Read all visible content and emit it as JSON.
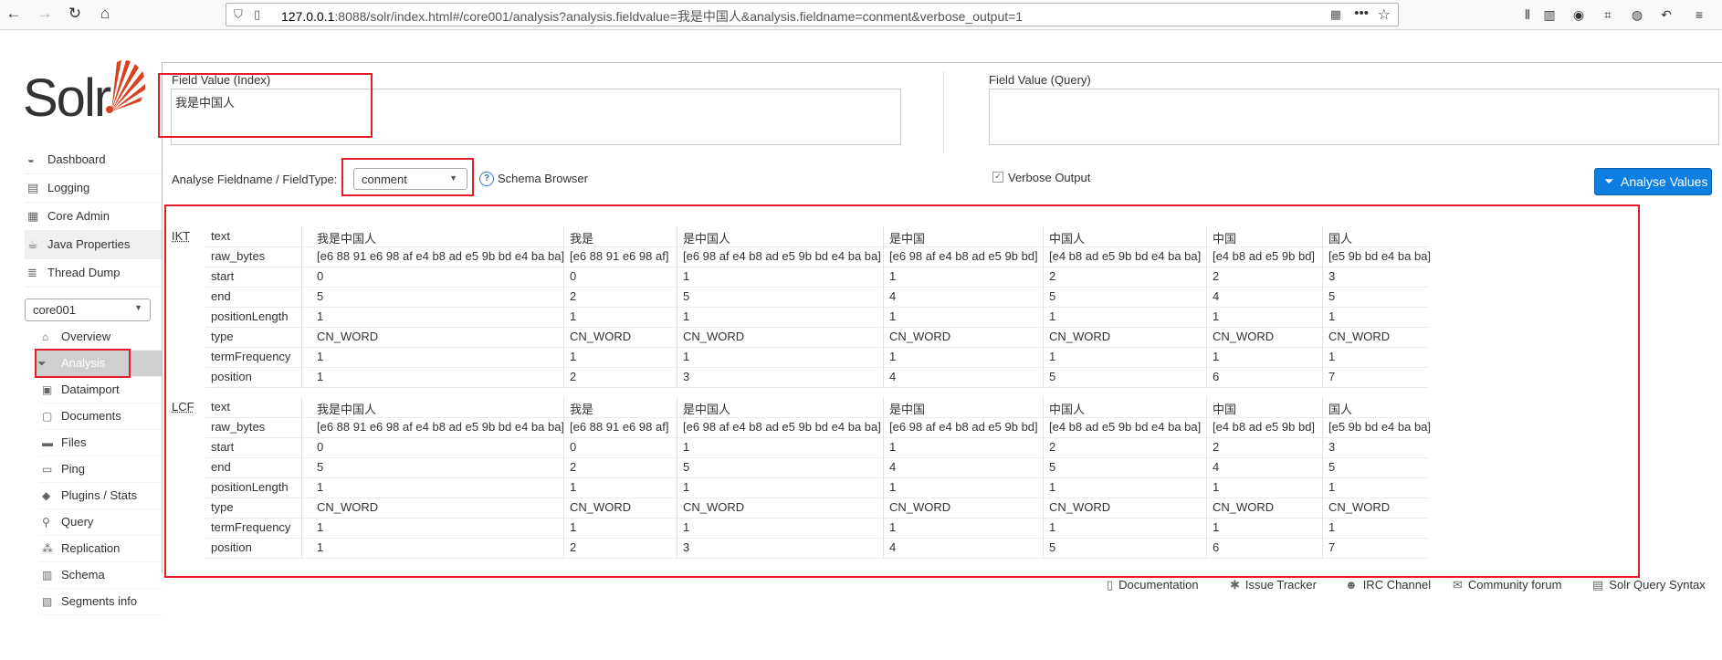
{
  "browser": {
    "url_host": "127.0.0.1",
    "url_rest": ":8088/solr/index.html#/core001/analysis?analysis.fieldvalue=我是中国人&analysis.fieldname=conment&verbose_output=1"
  },
  "logo": {
    "text": "Solr"
  },
  "menu": [
    {
      "label": "Dashboard",
      "icon": "dashboard-icon",
      "glyph": "◒"
    },
    {
      "label": "Logging",
      "icon": "logging-icon",
      "glyph": "▤"
    },
    {
      "label": "Core Admin",
      "icon": "core-admin-icon",
      "glyph": "▦"
    },
    {
      "label": "Java Properties",
      "icon": "java-icon",
      "glyph": "☕"
    },
    {
      "label": "Thread Dump",
      "icon": "thread-dump-icon",
      "glyph": "≣"
    }
  ],
  "core_selector": {
    "value": "core001"
  },
  "submenu": [
    {
      "label": "Overview",
      "icon": "home-icon",
      "glyph": "⌂"
    },
    {
      "label": "Analysis",
      "icon": "funnel-icon",
      "glyph": "⏷"
    },
    {
      "label": "Dataimport",
      "icon": "dataimport-icon",
      "glyph": "▣"
    },
    {
      "label": "Documents",
      "icon": "documents-icon",
      "glyph": "▢"
    },
    {
      "label": "Files",
      "icon": "folder-icon",
      "glyph": "▬"
    },
    {
      "label": "Ping",
      "icon": "ping-icon",
      "glyph": "▭"
    },
    {
      "label": "Plugins / Stats",
      "icon": "plugins-icon",
      "glyph": "◆"
    },
    {
      "label": "Query",
      "icon": "magnifier-icon",
      "glyph": "⚲"
    },
    {
      "label": "Replication",
      "icon": "replication-icon",
      "glyph": "⁂"
    },
    {
      "label": "Schema",
      "icon": "schema-icon",
      "glyph": "▥"
    },
    {
      "label": "Segments info",
      "icon": "segments-icon",
      "glyph": "▧"
    }
  ],
  "analysis": {
    "index_label": "Field Value (Index)",
    "index_value": "我是中国人",
    "query_label": "Field Value (Query)",
    "query_value": "",
    "fieldname_label": "Analyse Fieldname / FieldType:",
    "fieldname_value": "conment",
    "schema_browser": "Schema Browser",
    "verbose_label": "Verbose Output",
    "analyse_button": "Analyse Values"
  },
  "row_keys": [
    "text",
    "raw_bytes",
    "start",
    "end",
    "positionLength",
    "type",
    "termFrequency",
    "position"
  ],
  "stages": [
    {
      "name": "IKT",
      "tokens": [
        [
          "我是中国人",
          "[e6 88 91 e6 98 af e4 b8 ad e5 9b bd e4 ba ba]",
          "0",
          "5",
          "1",
          "CN_WORD",
          "1",
          "1"
        ],
        [
          "我是",
          "[e6 88 91 e6 98 af]",
          "0",
          "2",
          "1",
          "CN_WORD",
          "1",
          "2"
        ],
        [
          "是中国人",
          "[e6 98 af e4 b8 ad e5 9b bd e4 ba ba]",
          "1",
          "5",
          "1",
          "CN_WORD",
          "1",
          "3"
        ],
        [
          "是中国",
          "[e6 98 af e4 b8 ad e5 9b bd]",
          "1",
          "4",
          "1",
          "CN_WORD",
          "1",
          "4"
        ],
        [
          "中国人",
          "[e4 b8 ad e5 9b bd e4 ba ba]",
          "2",
          "5",
          "1",
          "CN_WORD",
          "1",
          "5"
        ],
        [
          "中国",
          "[e4 b8 ad e5 9b bd]",
          "2",
          "4",
          "1",
          "CN_WORD",
          "1",
          "6"
        ],
        [
          "国人",
          "[e5 9b bd e4 ba ba]",
          "3",
          "5",
          "1",
          "CN_WORD",
          "1",
          "7"
        ]
      ]
    },
    {
      "name": "LCF",
      "tokens": [
        [
          "我是中国人",
          "[e6 88 91 e6 98 af e4 b8 ad e5 9b bd e4 ba ba]",
          "0",
          "5",
          "1",
          "CN_WORD",
          "1",
          "1"
        ],
        [
          "我是",
          "[e6 88 91 e6 98 af]",
          "0",
          "2",
          "1",
          "CN_WORD",
          "1",
          "2"
        ],
        [
          "是中国人",
          "[e6 98 af e4 b8 ad e5 9b bd e4 ba ba]",
          "1",
          "5",
          "1",
          "CN_WORD",
          "1",
          "3"
        ],
        [
          "是中国",
          "[e6 98 af e4 b8 ad e5 9b bd]",
          "1",
          "4",
          "1",
          "CN_WORD",
          "1",
          "4"
        ],
        [
          "中国人",
          "[e4 b8 ad e5 9b bd e4 ba ba]",
          "2",
          "5",
          "1",
          "CN_WORD",
          "1",
          "5"
        ],
        [
          "中国",
          "[e4 b8 ad e5 9b bd]",
          "2",
          "4",
          "1",
          "CN_WORD",
          "1",
          "6"
        ],
        [
          "国人",
          "[e5 9b bd e4 ba ba]",
          "3",
          "5",
          "1",
          "CN_WORD",
          "1",
          "7"
        ]
      ]
    }
  ],
  "footer": [
    {
      "label": "Documentation",
      "icon": "documentation-icon",
      "glyph": "▯"
    },
    {
      "label": "Issue Tracker",
      "icon": "bug-icon",
      "glyph": "✱"
    },
    {
      "label": "IRC Channel",
      "icon": "irc-icon",
      "glyph": "☻"
    },
    {
      "label": "Community forum",
      "icon": "mail-icon",
      "glyph": "✉"
    },
    {
      "label": "Solr Query Syntax",
      "icon": "syntax-icon",
      "glyph": "▤"
    }
  ],
  "colors": {
    "accent": "#0e7ee3",
    "highlight": "#e41e26",
    "logo_red": "#d9411e"
  }
}
